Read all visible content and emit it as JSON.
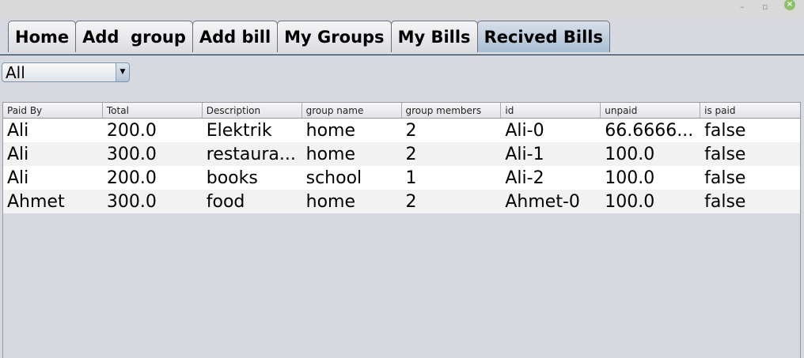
{
  "window": {
    "minimize": "–",
    "maximize": "▫",
    "close": "×"
  },
  "tabs": [
    "Home",
    "Add  group",
    "Add bill",
    "My Groups",
    "My Bills",
    "Recived Bills"
  ],
  "active_tab": 5,
  "filter": {
    "selected": "All"
  },
  "table": {
    "columns": [
      "Paid By",
      "Total",
      "Description",
      "group name",
      "group members",
      "id",
      "unpaid",
      "is paid"
    ],
    "rows": [
      [
        "Ali",
        "200.0",
        "Elektrik",
        "home",
        "2",
        "Ali-0",
        "66.6666...",
        "false"
      ],
      [
        "Ali",
        "300.0",
        "restaura...",
        "home",
        "2",
        "Ali-1",
        "100.0",
        "false"
      ],
      [
        "Ali",
        "200.0",
        "books",
        "school",
        "1",
        "Ali-2",
        "100.0",
        "false"
      ],
      [
        "Ahmet",
        "300.0",
        "food",
        "home",
        "2",
        "Ahmet-0",
        "100.0",
        "false"
      ]
    ]
  }
}
